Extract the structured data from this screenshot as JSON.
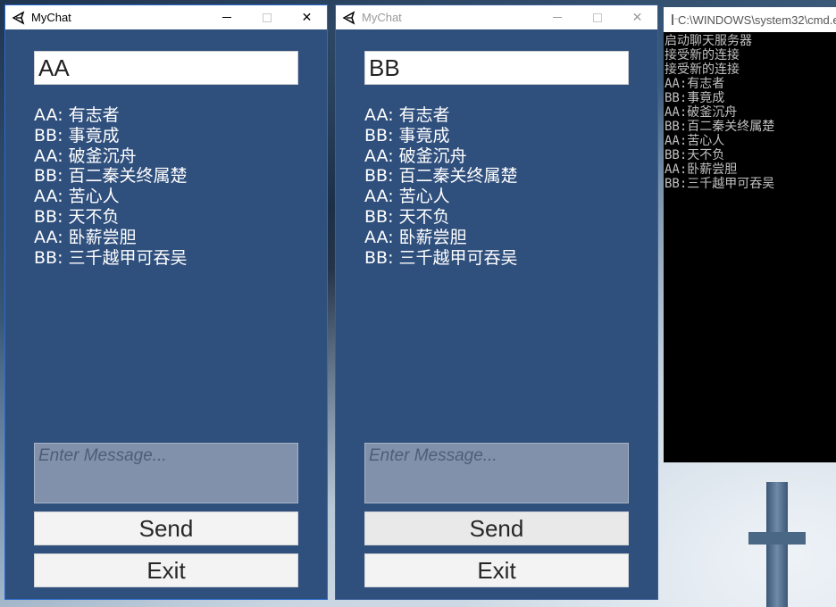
{
  "windows": [
    {
      "title": "MyChat",
      "name_value": "AA",
      "messages": [
        "AA: 有志者",
        "BB: 事竟成",
        "AA: 破釜沉舟",
        "BB: 百二秦关终属楚",
        "AA: 苦心人",
        "BB: 天不负",
        "AA: 卧薪尝胆",
        "BB: 三千越甲可吞吴"
      ],
      "input_placeholder": "Enter Message...",
      "send_label": "Send",
      "exit_label": "Exit"
    },
    {
      "title": "MyChat",
      "name_value": "BB",
      "messages": [
        "AA: 有志者",
        "BB: 事竟成",
        "AA: 破釜沉舟",
        "BB: 百二秦关终属楚",
        "AA: 苦心人",
        "BB: 天不负",
        "AA: 卧薪尝胆",
        "BB: 三千越甲可吞吴"
      ],
      "input_placeholder": "Enter Message...",
      "send_label": "Send",
      "exit_label": "Exit"
    }
  ],
  "titlebar_controls": {
    "close_glyph": "✕"
  },
  "console": {
    "title": "C:\\WINDOWS\\system32\\cmd.exe",
    "lines": [
      "启动聊天服务器",
      "接受新的连接",
      "接受新的连接",
      "AA:有志者",
      "BB:事竟成",
      "AA:破釜沉舟",
      "BB:百二秦关终属楚",
      "AA:苦心人",
      "BB:天不负",
      "AA:卧薪尝胆",
      "BB:三千越甲可吞吴"
    ]
  },
  "colors": {
    "window_background": "#2f4f7d",
    "input_background": "#8291ab",
    "button_background": "#f3f3f3",
    "console_background": "#000000",
    "console_text": "#c0c0c0"
  }
}
